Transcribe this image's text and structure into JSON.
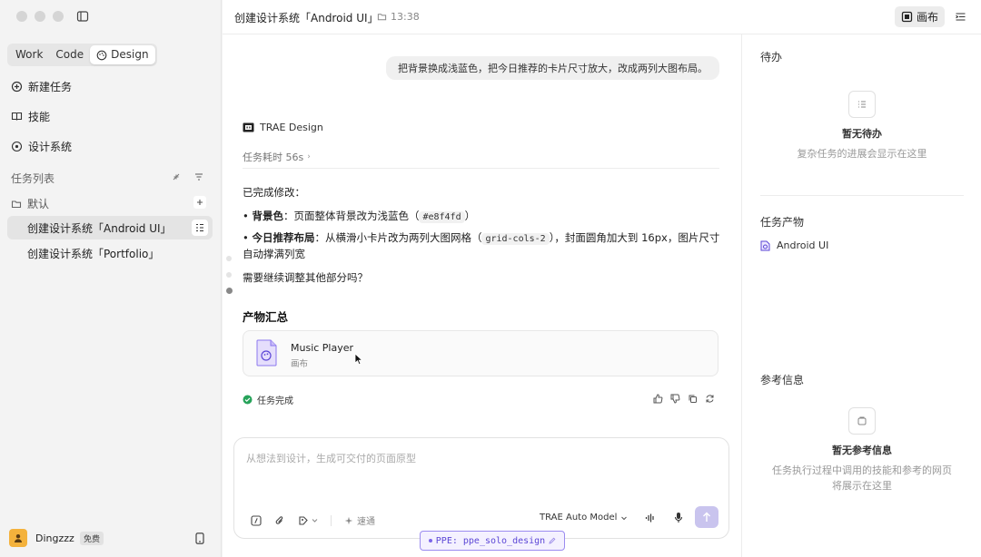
{
  "sidebar": {
    "modes": [
      "Work",
      "Code",
      "Design"
    ],
    "active_mode": "Design",
    "nav": {
      "new_task": "新建任务",
      "skills": "技能",
      "design_system": "设计系统"
    },
    "task_list_label": "任务列表",
    "folder_label": "默认",
    "tasks": [
      "创建设计系统「Android UI」",
      "创建设计系统「Portfolio」"
    ],
    "user": {
      "name": "Dingzzz",
      "badge": "免费"
    }
  },
  "header": {
    "title": "创建设计系统「Android UI」",
    "time": "13:38",
    "canvas_label": "画布"
  },
  "chat": {
    "user_message": "把背景换成浅蓝色，把今日推荐的卡片尺寸放大，改成两列大图布局。",
    "agent_name": "TRAE Design",
    "duration": "任务耗时 56s",
    "done_heading": "已完成修改：",
    "bullets": [
      {
        "label": "背景色",
        "pre": "：页面整体背景改为浅蓝色（",
        "code": "#e8f4fd",
        "post": "）"
      },
      {
        "label": "今日推荐布局",
        "pre": "：从横滑小卡片改为两列大图网格（",
        "code": "grid-cols-2",
        "post": "），封面圆角加大到 16px，图片尺寸自动撑满列宽"
      }
    ],
    "followup": "需要继续调整其他部分吗？",
    "artifacts_heading": "产物汇总",
    "artifact": {
      "name": "Music Player",
      "type": "画布"
    },
    "status": "任务完成"
  },
  "composer": {
    "placeholder": "从想法到设计，生成可交付的页面原型",
    "speed_label": "速通",
    "model": "TRAE Auto Model"
  },
  "ppe_tag": "PPE: ppe_solo_design",
  "right_panel": {
    "todo_title": "待办",
    "todo_empty_title": "暂无待办",
    "todo_empty_desc": "复杂任务的进展会显示在这里",
    "artifacts_title": "任务产物",
    "artifact_item": "Android UI",
    "ref_title": "参考信息",
    "ref_empty_title": "暂无参考信息",
    "ref_empty_desc_1": "任务执行过程中调用的技能和参考的网页",
    "ref_empty_desc_2": "将展示在这里"
  },
  "colors": {
    "accent": "#5b46d6",
    "success": "#27a35a"
  }
}
